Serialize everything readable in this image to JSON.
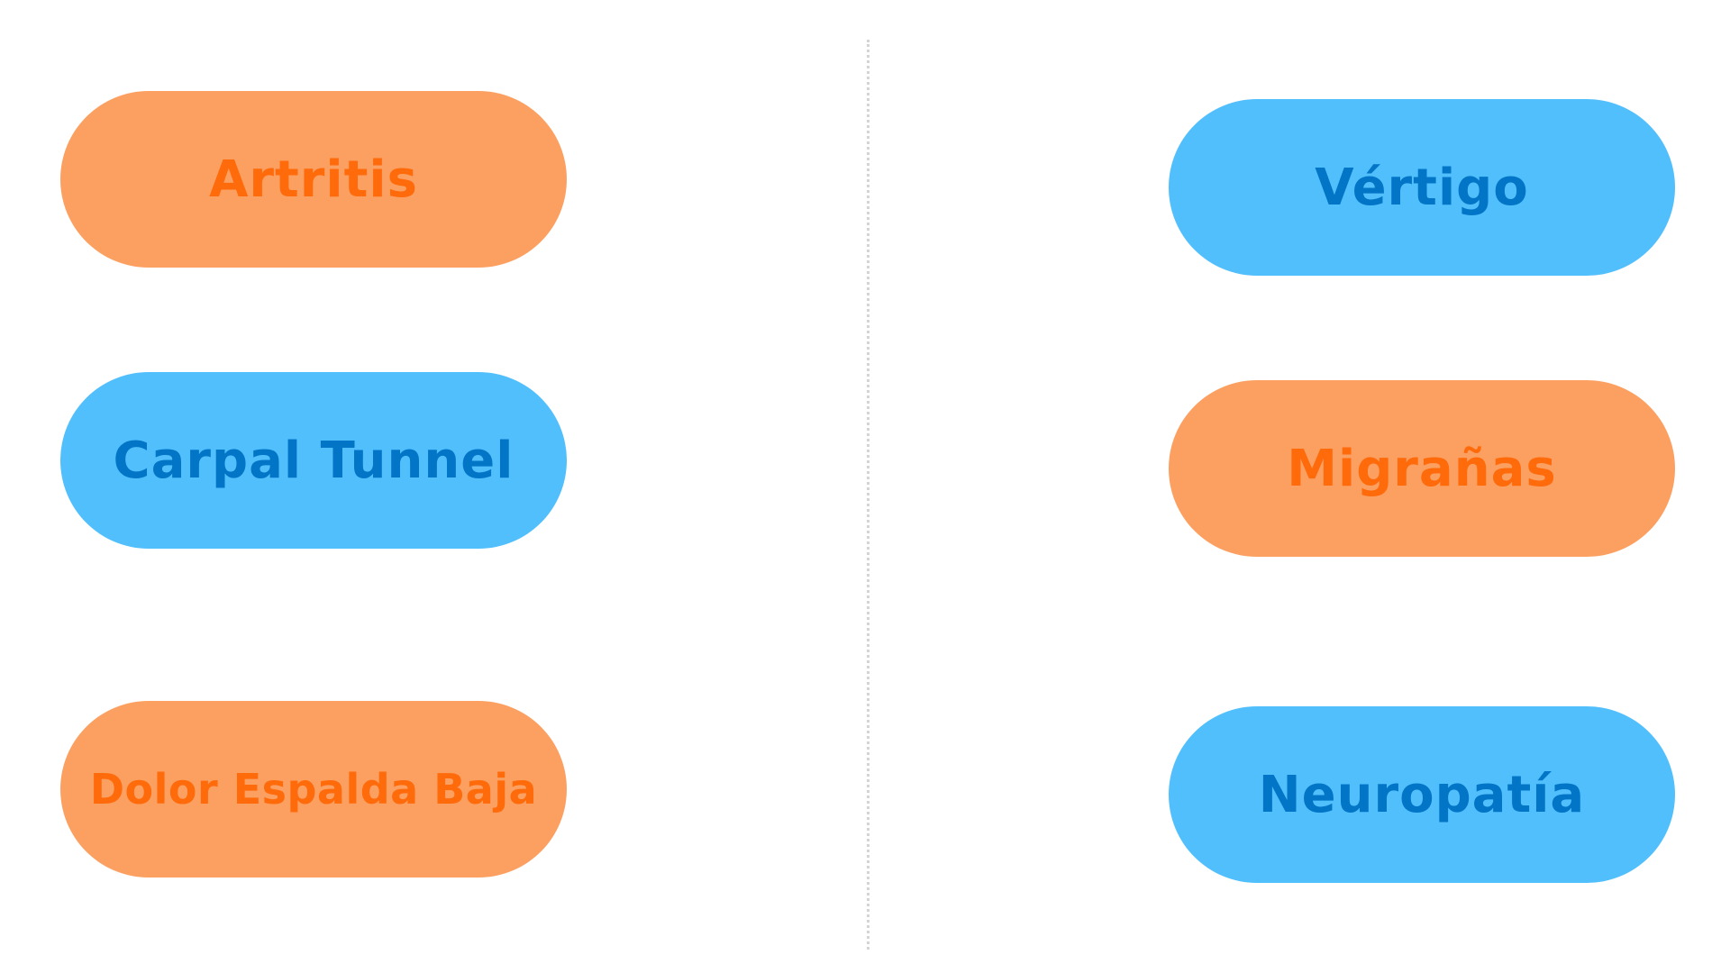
{
  "left_column": [
    {
      "label": "Artritis",
      "color": "orange"
    },
    {
      "label": "Carpal Tunnel",
      "color": "blue"
    },
    {
      "label": "Dolor Espalda Baja",
      "color": "orange"
    }
  ],
  "right_column": [
    {
      "label": "Vértigo",
      "color": "blue"
    },
    {
      "label": "Migrañas",
      "color": "orange"
    },
    {
      "label": "Neuropatía",
      "color": "blue"
    }
  ],
  "colors": {
    "orange_fill": "#fca062",
    "orange_text": "#ff6a0a",
    "blue_fill": "#52bffd",
    "blue_text": "#0275c7",
    "divider": "#d4d4d4"
  }
}
